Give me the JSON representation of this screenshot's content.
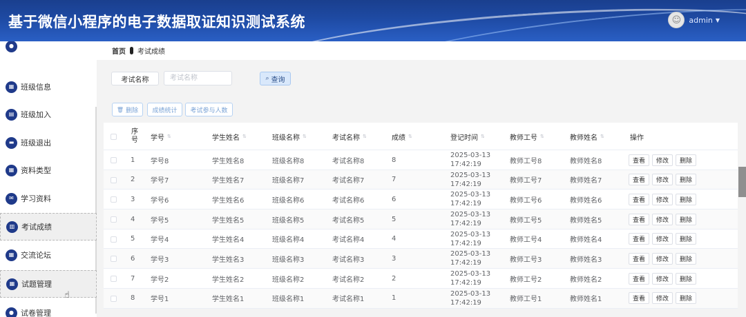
{
  "app": {
    "title": "基于微信小程序的电子数据取证知识测试系统",
    "username": "admin"
  },
  "sidebar": {
    "items": [
      {
        "label": "",
        "icon": "circle-icon"
      },
      {
        "label": "班级信息",
        "icon": "grid-icon"
      },
      {
        "label": "班级加入",
        "icon": "document-icon"
      },
      {
        "label": "班级退出",
        "icon": "monitor-icon"
      },
      {
        "label": "资料类型",
        "icon": "grid-icon"
      },
      {
        "label": "学习资料",
        "icon": "chat-icon"
      },
      {
        "label": "考试成绩",
        "icon": "clipboard-icon"
      },
      {
        "label": "交流论坛",
        "icon": "grid-icon"
      },
      {
        "label": "试题管理",
        "icon": "grid-icon"
      },
      {
        "label": "试卷管理",
        "icon": "user-icon"
      }
    ]
  },
  "breadcrumb": {
    "home": "首页",
    "current": "考试成绩"
  },
  "search": {
    "label": "考试名称",
    "placeholder": "考试名称",
    "query_label": "查询"
  },
  "actions": {
    "delete_label": "删除",
    "stats_label": "成绩统计",
    "participants_label": "考试参与人数"
  },
  "table": {
    "headers": {
      "index": "序号",
      "student_no": "学号",
      "student_name": "学生姓名",
      "class_name": "班级名称",
      "exam_name": "考试名称",
      "score": "成绩",
      "reg_time": "登记时间",
      "teacher_no": "教师工号",
      "teacher_name": "教师姓名",
      "ops": "操作"
    },
    "ops": {
      "view": "查看",
      "edit": "修改",
      "delete": "删除"
    },
    "rows": [
      {
        "index": "1",
        "student_no": "学号8",
        "student_name": "学生姓名8",
        "class_name": "班级名称8",
        "exam_name": "考试名称8",
        "score": "8",
        "reg_time": "2025-03-13 17:42:19",
        "teacher_no": "教师工号8",
        "teacher_name": "教师姓名8"
      },
      {
        "index": "2",
        "student_no": "学号7",
        "student_name": "学生姓名7",
        "class_name": "班级名称7",
        "exam_name": "考试名称7",
        "score": "7",
        "reg_time": "2025-03-13 17:42:19",
        "teacher_no": "教师工号7",
        "teacher_name": "教师姓名7"
      },
      {
        "index": "3",
        "student_no": "学号6",
        "student_name": "学生姓名6",
        "class_name": "班级名称6",
        "exam_name": "考试名称6",
        "score": "6",
        "reg_time": "2025-03-13 17:42:19",
        "teacher_no": "教师工号6",
        "teacher_name": "教师姓名6"
      },
      {
        "index": "4",
        "student_no": "学号5",
        "student_name": "学生姓名5",
        "class_name": "班级名称5",
        "exam_name": "考试名称5",
        "score": "5",
        "reg_time": "2025-03-13 17:42:19",
        "teacher_no": "教师工号5",
        "teacher_name": "教师姓名5"
      },
      {
        "index": "5",
        "student_no": "学号4",
        "student_name": "学生姓名4",
        "class_name": "班级名称4",
        "exam_name": "考试名称4",
        "score": "4",
        "reg_time": "2025-03-13 17:42:19",
        "teacher_no": "教师工号4",
        "teacher_name": "教师姓名4"
      },
      {
        "index": "6",
        "student_no": "学号3",
        "student_name": "学生姓名3",
        "class_name": "班级名称3",
        "exam_name": "考试名称3",
        "score": "3",
        "reg_time": "2025-03-13 17:42:19",
        "teacher_no": "教师工号3",
        "teacher_name": "教师姓名3"
      },
      {
        "index": "7",
        "student_no": "学号2",
        "student_name": "学生姓名2",
        "class_name": "班级名称2",
        "exam_name": "考试名称2",
        "score": "2",
        "reg_time": "2025-03-13 17:42:19",
        "teacher_no": "教师工号2",
        "teacher_name": "教师姓名2"
      },
      {
        "index": "8",
        "student_no": "学号1",
        "student_name": "学生姓名1",
        "class_name": "班级名称1",
        "exam_name": "考试名称1",
        "score": "1",
        "reg_time": "2025-03-13 17:42:19",
        "teacher_no": "教师工号1",
        "teacher_name": "教师姓名1"
      }
    ]
  }
}
